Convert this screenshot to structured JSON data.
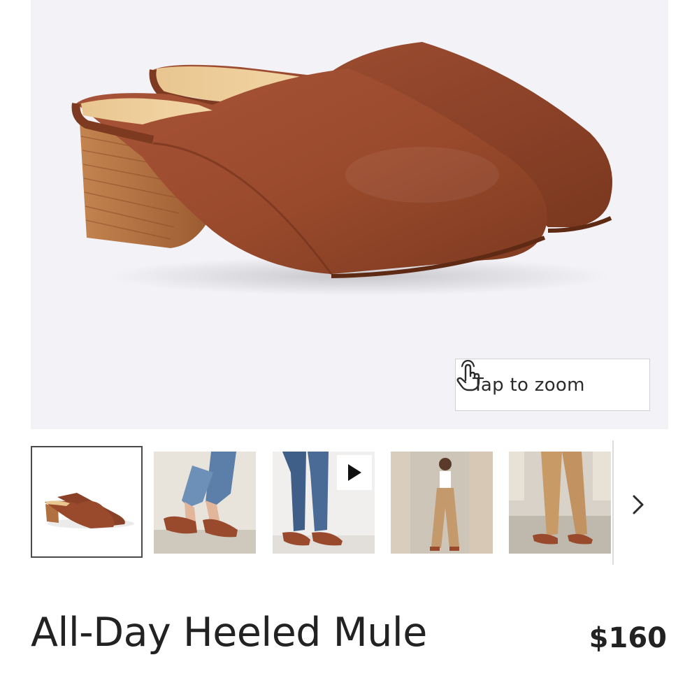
{
  "product": {
    "title": "All-Day Heeled Mule",
    "price": "$160"
  },
  "gallery": {
    "zoom_label": "Tap to zoom",
    "zoom_icon": "hand-tap-icon",
    "next_icon": "chevron-right-icon",
    "play_icon": "play-icon",
    "selected_index": 0,
    "thumbnails": [
      {
        "subject": "mules-product"
      },
      {
        "subject": "jeans-mules"
      },
      {
        "subject": "jeans-mules-video"
      },
      {
        "subject": "model-tan-pants"
      },
      {
        "subject": "tan-pants-mules"
      }
    ]
  },
  "colors": {
    "leather": "#9a4a2c",
    "heel_wood": "#b07040",
    "background": "#f3f2f7"
  }
}
